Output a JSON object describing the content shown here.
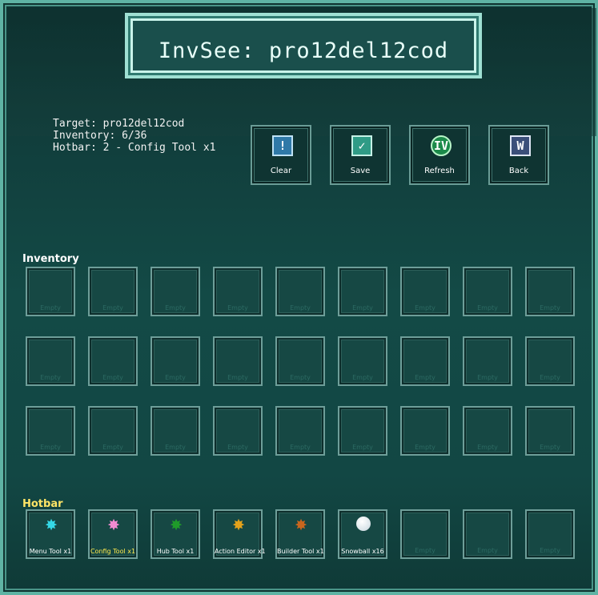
{
  "title": "InvSee: pro12del12cod",
  "info": {
    "target": "Target: pro12del12cod",
    "inventory": "Inventory: 6/36",
    "hotbar": "Hotbar: 2 - Config Tool x1"
  },
  "buttons": [
    {
      "label": "Clear",
      "icon": "!",
      "icon_name": "exclamation-icon"
    },
    {
      "label": "Save",
      "icon": "✓",
      "icon_name": "checkmark-icon"
    },
    {
      "label": "Refresh",
      "icon": "IV",
      "icon_name": "refresh-orb-icon"
    },
    {
      "label": "Back",
      "icon": "W",
      "icon_name": "back-icon"
    }
  ],
  "inventory_label": "Inventory",
  "hotbar_label": "Hotbar",
  "empty_label": "Empty",
  "colors": {
    "inventory_label": "#ffffff",
    "hotbar_label": "#ffe566",
    "selected_item": "#ffe94d"
  },
  "inventory_rows": 3,
  "hotbar": [
    {
      "label": "Menu Tool x1",
      "icon": "cyan-gear-icon",
      "glyph": "✸",
      "color": "#35d8e6",
      "selected": false
    },
    {
      "label": "Config Tool x1",
      "icon": "pink-gear-icon",
      "glyph": "✸",
      "color": "#f28ad0",
      "selected": true
    },
    {
      "label": "Hub Tool x1",
      "icon": "green-gear-icon",
      "glyph": "✸",
      "color": "#1f9b2a",
      "selected": false
    },
    {
      "label": "Action Editor x1",
      "icon": "gold-gear-icon",
      "glyph": "✸",
      "color": "#e3a21c",
      "selected": false
    },
    {
      "label": "Builder Tool x1",
      "icon": "orange-gear-icon",
      "glyph": "✸",
      "color": "#c8661e",
      "selected": false
    },
    {
      "label": "Snowball x16",
      "icon": "snowball-icon",
      "glyph": "",
      "color": "#ffffff",
      "selected": false
    },
    {
      "label": "Empty",
      "icon": "",
      "glyph": "",
      "color": "",
      "selected": false
    },
    {
      "label": "Empty",
      "icon": "",
      "glyph": "",
      "color": "",
      "selected": false
    },
    {
      "label": "Empty",
      "icon": "",
      "glyph": "",
      "color": "",
      "selected": false
    }
  ]
}
